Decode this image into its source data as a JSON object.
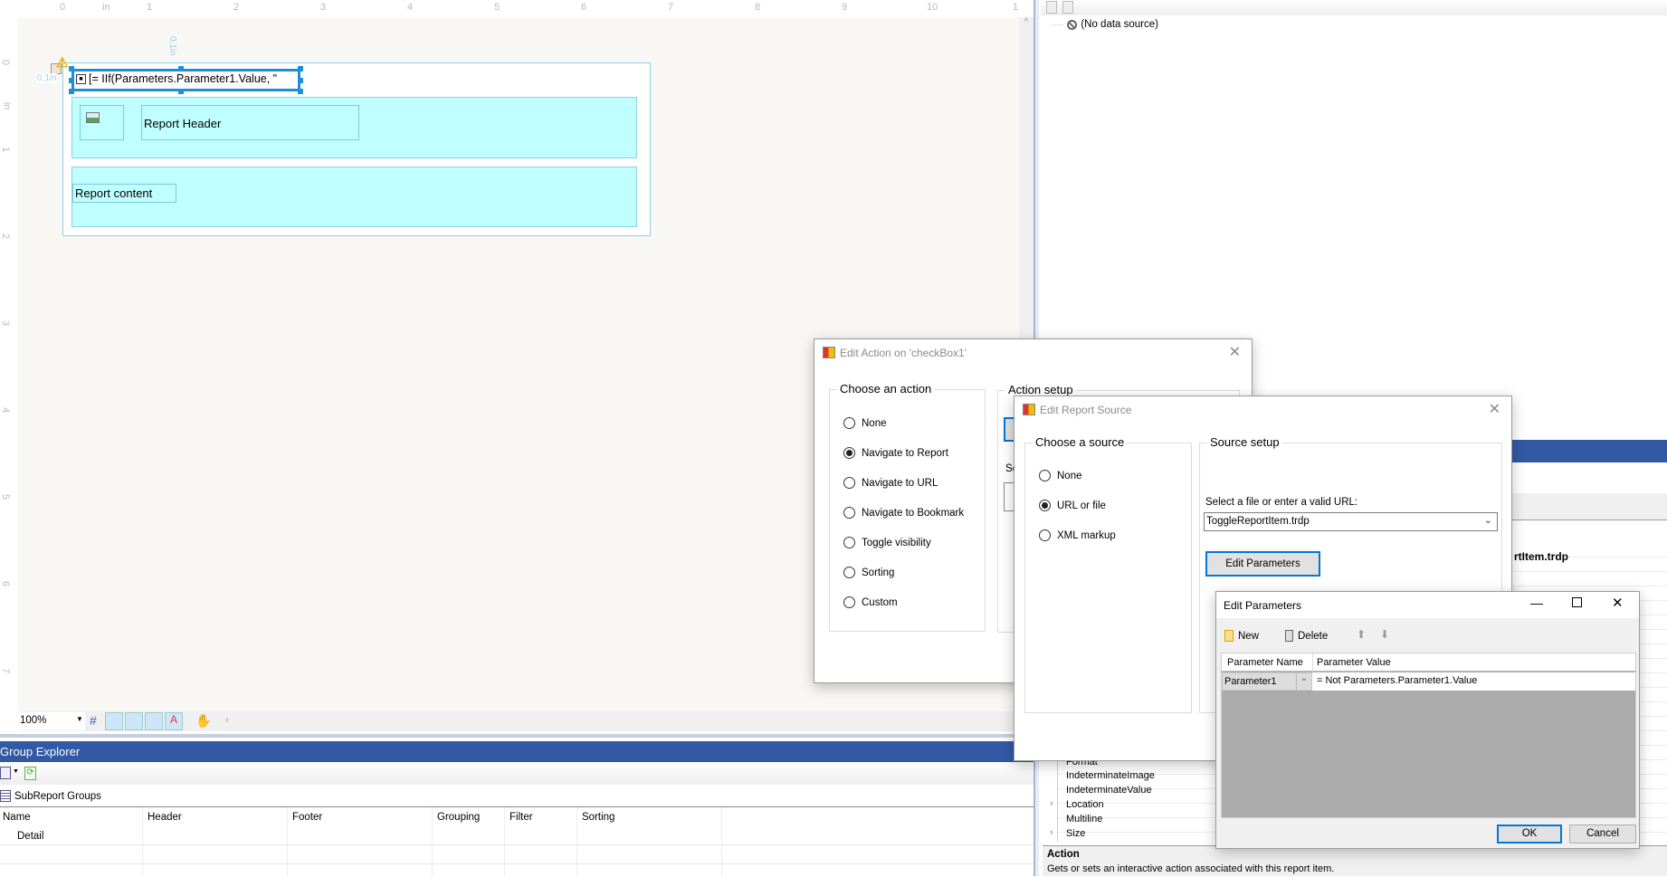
{
  "ruler": {
    "top_labels": [
      "0",
      "in",
      "1",
      "2",
      "3",
      "4",
      "5",
      "6",
      "7",
      "8",
      "9",
      "10",
      "1"
    ],
    "left_labels": [
      "0",
      "in",
      "1",
      "2",
      "3",
      "4",
      "5",
      "6",
      "7"
    ],
    "measure_label": "0.1in"
  },
  "designer": {
    "checkbox_expression": "[= IIf(Parameters.Parameter1.Value, \"",
    "report_header": "Report Header",
    "report_content": "Report content",
    "zoom": "100%"
  },
  "group_explorer": {
    "title": "Group Explorer",
    "tree_root": "SubReport Groups",
    "columns": [
      "Name",
      "Header",
      "Footer",
      "Grouping",
      "Filter",
      "Sorting"
    ],
    "rows": [
      [
        "Detail",
        "",
        "",
        "",
        "",
        ""
      ]
    ]
  },
  "data_explorer": {
    "item": "(No data source)"
  },
  "properties": {
    "partial_value": "rtItem.trdp",
    "items": [
      "Format",
      "IndeterminateImage",
      "IndeterminateValue",
      "Location",
      "Multiline",
      "Size"
    ],
    "description_title": "Action",
    "description_text": "Gets or sets an interactive action associated with this report item."
  },
  "edit_action_dialog": {
    "title": "Edit Action on 'checkBox1'",
    "choose_label": "Choose an action",
    "setup_label": "Action setup",
    "setup_partial_label": "Se",
    "options": [
      "None",
      "Navigate to Report",
      "Navigate to URL",
      "Navigate to Bookmark",
      "Toggle visibility",
      "Sorting",
      "Custom"
    ],
    "selected": "Navigate to Report"
  },
  "edit_report_source_dialog": {
    "title": "Edit Report Source",
    "choose_label": "Choose a source",
    "setup_label": "Source setup",
    "options": [
      "None",
      "URL or file",
      "XML markup"
    ],
    "selected": "URL or file",
    "url_label": "Select a file or enter a valid URL:",
    "url_value": "ToggleReportItem.trdp",
    "edit_parameters_button": "Edit Parameters"
  },
  "edit_parameters_dialog": {
    "title": "Edit Parameters",
    "new_label": "New",
    "delete_label": "Delete",
    "columns": [
      "Parameter Name",
      "Parameter Value"
    ],
    "rows": [
      {
        "name": "Parameter1",
        "value": "= Not Parameters.Parameter1.Value"
      }
    ],
    "ok_label": "OK",
    "cancel_label": "Cancel"
  },
  "colors": {
    "accent": "#0078d7",
    "panel_header": "#3359a4",
    "band": "#c0ffff",
    "selection": "#1e8fd6",
    "grid_empty": "#ababab"
  }
}
